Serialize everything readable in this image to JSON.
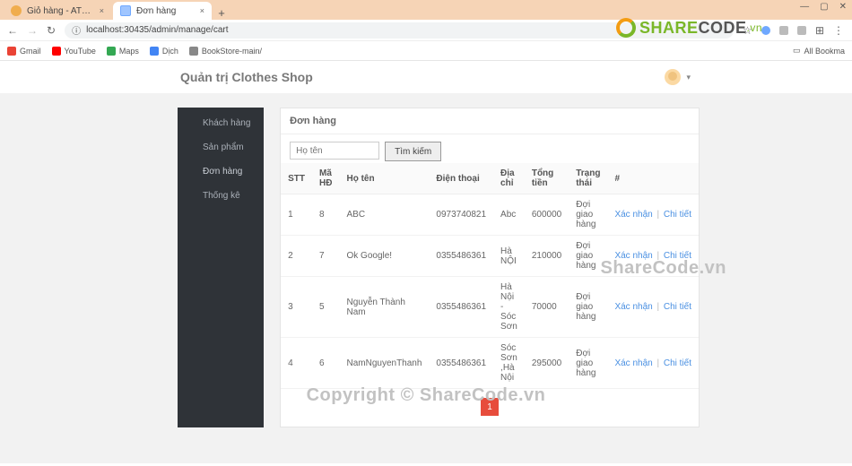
{
  "browser": {
    "tabs": [
      {
        "title": "Giỏ hàng - ATZ Shop",
        "active": false
      },
      {
        "title": "Đơn hàng",
        "active": true
      }
    ],
    "new_tab": "+",
    "window_controls": {
      "min": "—",
      "max": "▢",
      "close": "✕"
    },
    "nav": {
      "back": "←",
      "forward": "→",
      "reload": "↻"
    },
    "address": {
      "scheme_icon": "ⓘ",
      "url": "localhost:30435/admin/manage/cart"
    },
    "addr_right": {
      "star": "☆",
      "puzzle": "⊞",
      "menu": "⋮"
    },
    "bookmarks": [
      {
        "label": "Gmail",
        "color": "#ea4335"
      },
      {
        "label": "YouTube",
        "color": "#ff0000"
      },
      {
        "label": "Maps",
        "color": "#34a853"
      },
      {
        "label": "Dịch",
        "color": "#4285f4"
      },
      {
        "label": "BookStore-main/",
        "color": "#888"
      }
    ],
    "bookmarks_right": {
      "icon": "▭",
      "label": "All Bookma"
    }
  },
  "header": {
    "title": "Quản trị Clothes Shop",
    "caret": "▾"
  },
  "sidebar": {
    "items": [
      {
        "label": "Khách hàng",
        "icon": "👤"
      },
      {
        "label": "Sản phẩm",
        "icon": "📣"
      },
      {
        "label": "Đơn hàng",
        "icon": "🛒"
      },
      {
        "label": "Thống kê",
        "icon": "📈"
      }
    ]
  },
  "panel": {
    "title": "Đơn hàng",
    "search": {
      "placeholder": "Họ tên",
      "button": "Tìm kiếm"
    },
    "columns": [
      "STT",
      "Mã HĐ",
      "Họ tên",
      "Điện thoại",
      "Địa chỉ",
      "Tổng tiền",
      "Trạng thái",
      "#"
    ],
    "actions": {
      "confirm": "Xác nhận",
      "detail": "Chi tiết",
      "sep": "|"
    },
    "rows": [
      {
        "stt": "1",
        "ma": "8",
        "ten": "ABC",
        "dt": "0973740821",
        "dc": "Abc",
        "tt": "600000",
        "tr": "Đợi giao hàng"
      },
      {
        "stt": "2",
        "ma": "7",
        "ten": "Ok Google!",
        "dt": "0355486361",
        "dc": "Hà NỘI",
        "tt": "210000",
        "tr": "Đợi giao hàng"
      },
      {
        "stt": "3",
        "ma": "5",
        "ten": "Nguyễn Thành Nam",
        "dt": "0355486361",
        "dc": "Hà Nội - Sóc Sơn",
        "tt": "70000",
        "tr": "Đợi giao hàng"
      },
      {
        "stt": "4",
        "ma": "6",
        "ten": "NamNguyenThanh",
        "dt": "0355486361",
        "dc": "Sóc Sơn ,Hà Nội",
        "tt": "295000",
        "tr": "Đợi giao hàng"
      }
    ],
    "page": "1"
  },
  "watermark": {
    "brand_a": "SHARE",
    "brand_b": "CODE",
    "brand_tail": ".vn",
    "mid": "ShareCode.vn",
    "bottom": "Copyright © ShareCode.vn"
  }
}
